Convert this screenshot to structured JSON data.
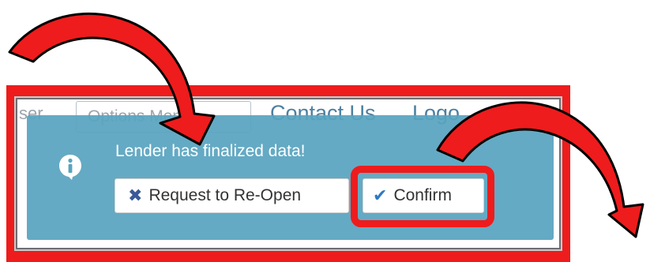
{
  "nav": {
    "user_partial": "ser",
    "options_menu": "Options Menu",
    "contact_us": "Contact Us",
    "logout_partial": "Logo"
  },
  "alert": {
    "message": "Lender has finalized data!",
    "icon": "info-icon",
    "buttons": {
      "reopen": {
        "label": "Request to Re-Open",
        "icon": "times-icon"
      },
      "confirm": {
        "label": "Confirm",
        "icon": "check-icon"
      }
    }
  },
  "colors": {
    "annotation_red": "#ee1c1c",
    "alert_background": "#58a4c0",
    "link_blue": "#4c7fa0"
  }
}
